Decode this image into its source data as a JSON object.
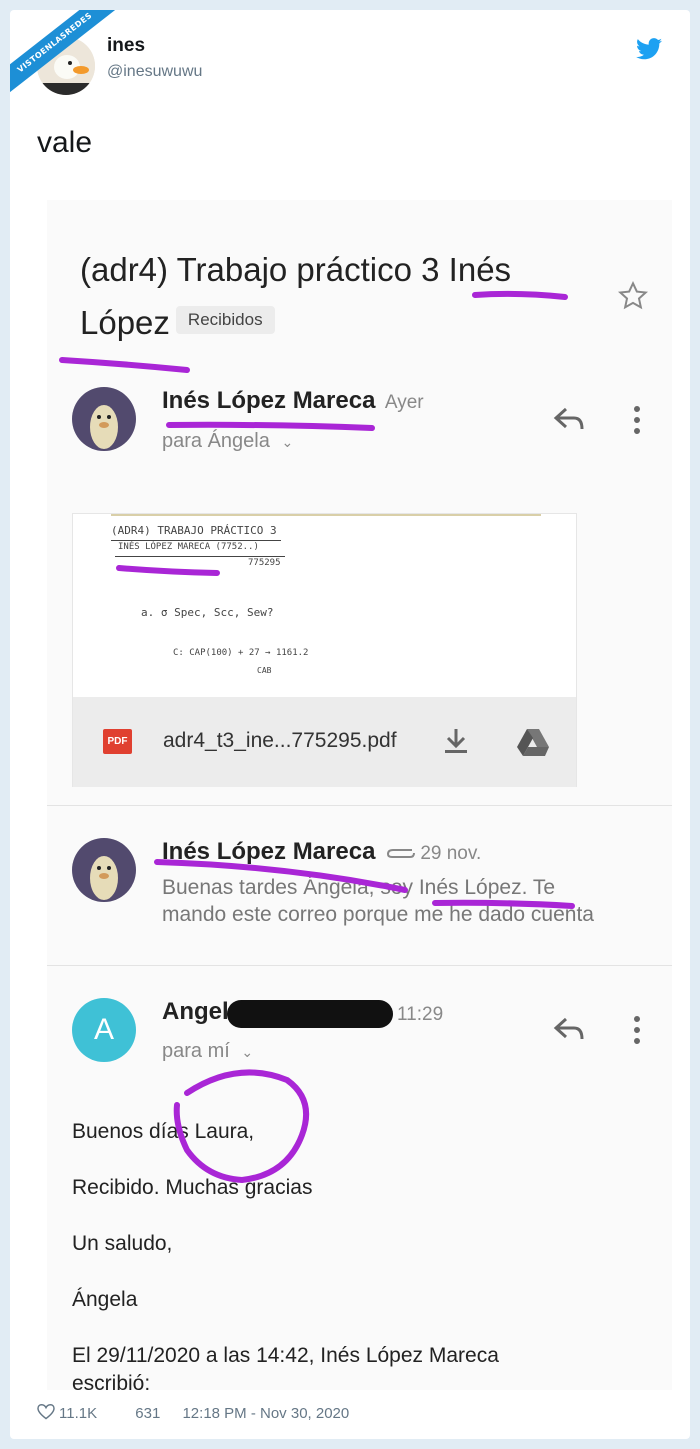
{
  "watermark": "VISTOENLASREDES",
  "tweet": {
    "name": "ines",
    "handle": "@inesuwuwu",
    "text": "vale",
    "likes": "11.1K",
    "replies": "631",
    "timestamp": "12:18 PM - Nov 30, 2020",
    "brand_color": "#1da1f2"
  },
  "email": {
    "subject": "(adr4) Trabajo práctico 3 Inés López",
    "subject_line1": "(adr4) Trabajo práctico 3 Inés",
    "subject_line2": "López",
    "label": "Recibidos",
    "highlight_color": "#a926d6",
    "messages": [
      {
        "sender": "Inés López Mareca",
        "time": "Ayer",
        "to": "para Ángela",
        "attachment": {
          "filename": "adr4_t3_ine...775295.pdf",
          "type_badge": "PDF",
          "preview_lines": [
            "(ADR4) TRABAJO PRÁCTICO 3",
            "INÉS LÓPEZ MARECA (7752..)",
            "775295",
            "a. σ Spec, Scc, Sew?",
            "C: CAP(100) + 27 → 1161.2",
            "CAB"
          ]
        }
      },
      {
        "sender": "Inés López Mareca",
        "time": "29 nov.",
        "snippet_line1": "Buenas tardes Ángela, soy Inés López. Te",
        "snippet_line2": "mando este correo porque me he dado cuenta"
      },
      {
        "avatar_letter": "A",
        "sender_visible": "Angel",
        "time": "11:29",
        "to": "para mí",
        "body": [
          "Buenos días Laura,",
          "Recibido. Muchas gracias",
          "Un saludo,",
          "Ángela",
          "El 29/11/2020 a las 14:42, Inés López Mareca",
          "escribió:"
        ]
      }
    ]
  }
}
